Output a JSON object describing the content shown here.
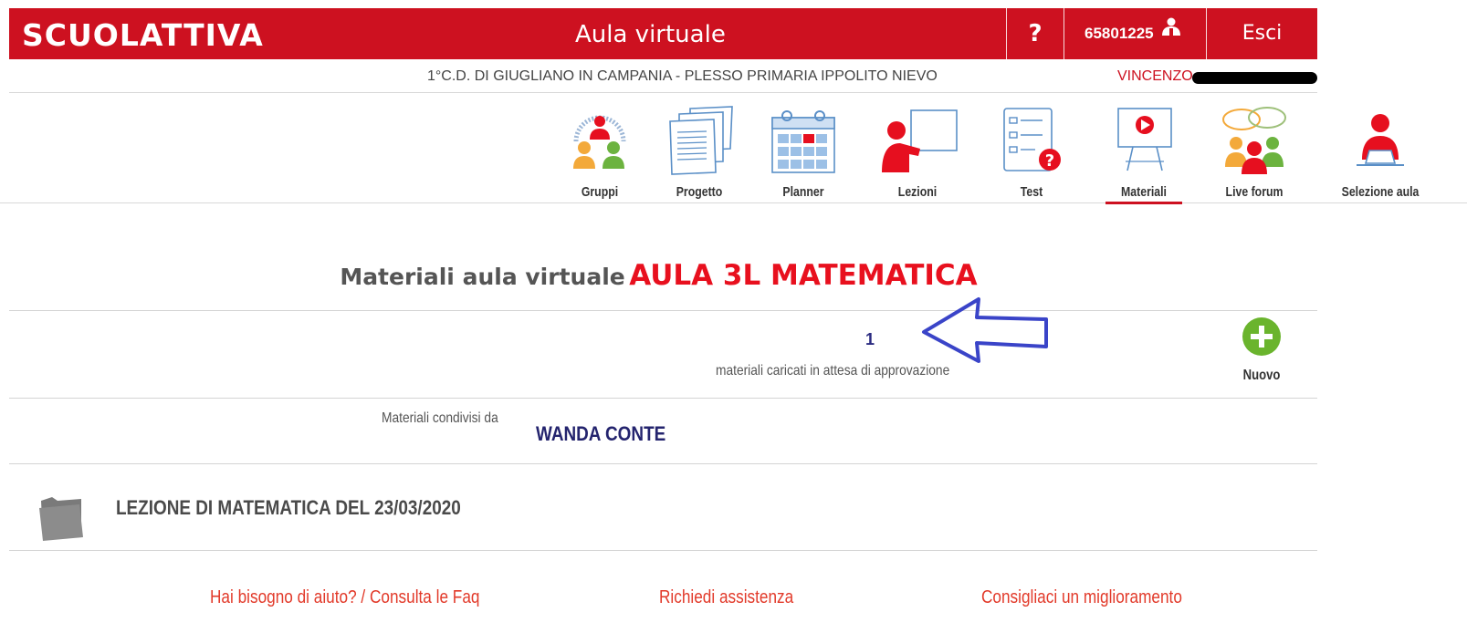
{
  "header": {
    "logo_text": "SCUOLATTIVA",
    "app_title": "Aula virtuale",
    "help_label": "?",
    "user_id": "65801225",
    "logout_label": "Esci",
    "brand_color": "#cd1120"
  },
  "school": {
    "name": "1°C.D. DI GIUGLIANO IN CAMPANIA - PLESSO PRIMARIA IPPOLITO NIEVO",
    "user_first_name": "VINCENZO"
  },
  "nav": {
    "items": [
      {
        "label": "Gruppi",
        "icon": "groups-icon"
      },
      {
        "label": "Progetto",
        "icon": "documents-icon"
      },
      {
        "label": "Planner",
        "icon": "calendar-icon"
      },
      {
        "label": "Lezioni",
        "icon": "teacher-board-icon"
      },
      {
        "label": "Test",
        "icon": "test-sheet-icon"
      },
      {
        "label": "Materiali",
        "icon": "video-board-icon"
      },
      {
        "label": "Live forum",
        "icon": "chat-people-icon"
      },
      {
        "label": "Selezione aula",
        "icon": "user-laptop-icon"
      }
    ],
    "active": "Materiali"
  },
  "main": {
    "heading_static": "Materiali aula virtuale",
    "class_name": "AULA 3L MATEMATICA",
    "pending_count": "1",
    "pending_text": "materiali caricati in attesa di approvazione",
    "new_label": "Nuovo",
    "shared_by_label": "Materiali condivisi da",
    "shared_by_name": "WANDA CONTE"
  },
  "materials": [
    {
      "title": "LEZIONE DI MATEMATICA DEL 23/03/2020",
      "icon": "folder-icon"
    }
  ],
  "footer": {
    "help_faq": "Hai bisogno di aiuto? / Consulta le Faq",
    "assistance": "Richiedi assistenza",
    "suggest": "Consigliaci un miglioramento"
  }
}
